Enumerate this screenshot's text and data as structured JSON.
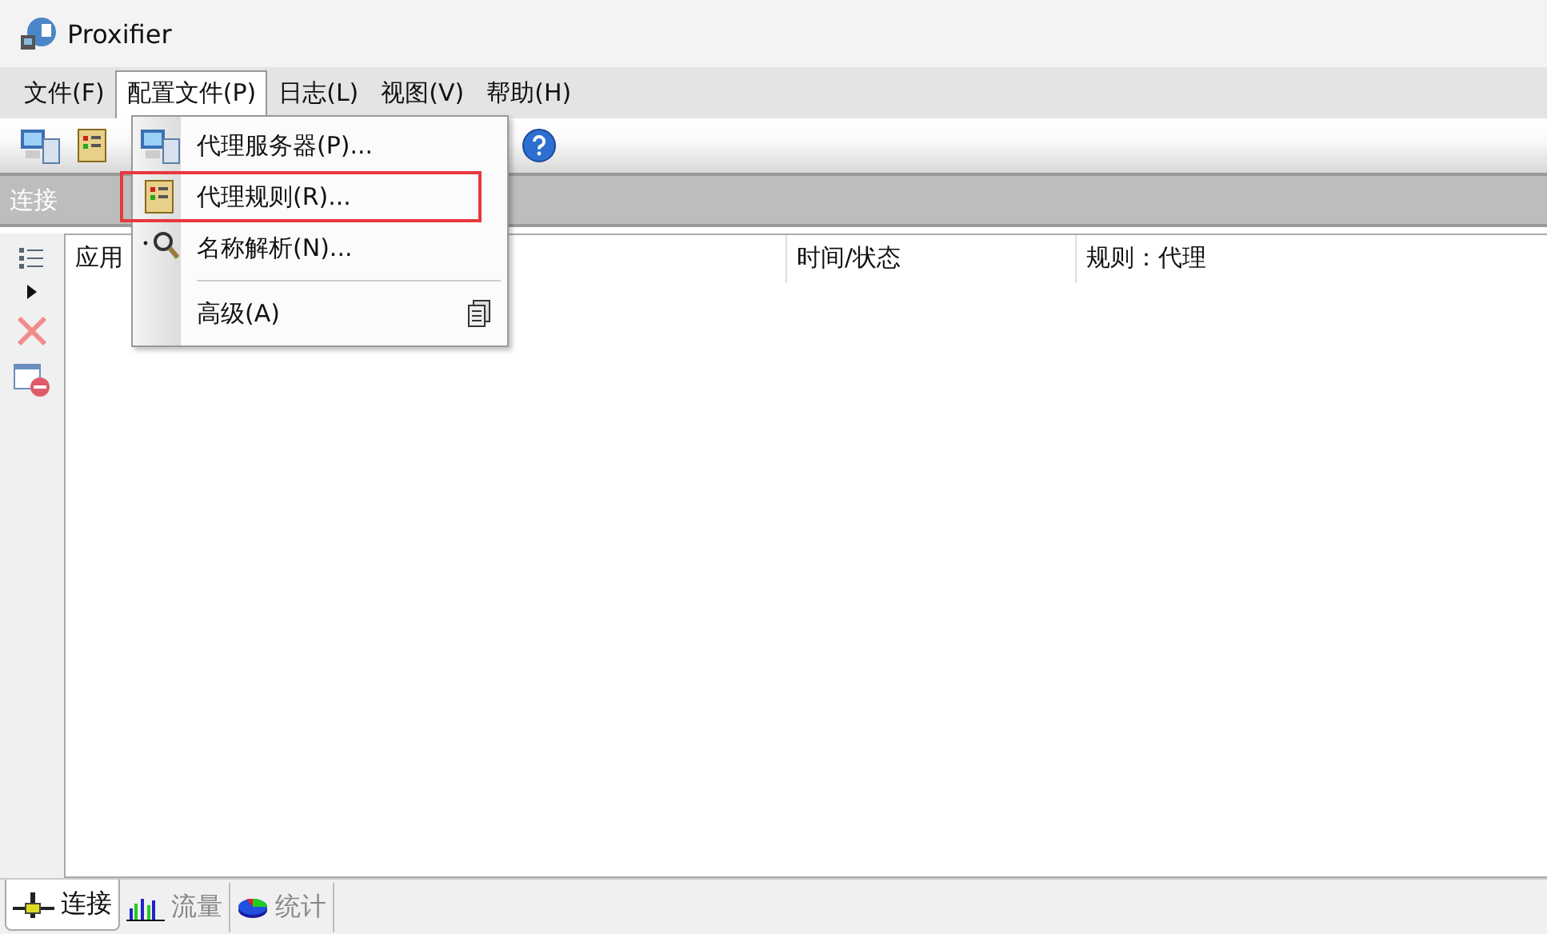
{
  "window": {
    "title": "Proxifier"
  },
  "menu_bar": [
    {
      "label": "文件(F)",
      "selected": false
    },
    {
      "label": "配置文件(P)",
      "selected": true
    },
    {
      "label": "日志(L)",
      "selected": false
    },
    {
      "label": "视图(V)",
      "selected": false
    },
    {
      "label": "帮助(H)",
      "selected": false
    }
  ],
  "dropdown": [
    {
      "kind": "servers",
      "label": "代理服务器(P)...",
      "highlighted": false
    },
    {
      "kind": "rules",
      "label": "代理规则(R)...",
      "highlighted": true
    },
    {
      "kind": "dns",
      "label": "名称解析(N)...",
      "highlighted": false
    },
    {
      "kind": "separator"
    },
    {
      "kind": "advanced",
      "label": "高级(A)",
      "highlighted": false
    }
  ],
  "section_header": "连接",
  "table": {
    "columns": [
      "应用",
      "时间/状态",
      "规则：代理"
    ]
  },
  "bottom_tabs": [
    {
      "kind": "connections",
      "label": "连接",
      "selected": true
    },
    {
      "kind": "traffic",
      "label": "流量",
      "selected": false
    },
    {
      "kind": "statistics",
      "label": "统计",
      "selected": false
    }
  ]
}
